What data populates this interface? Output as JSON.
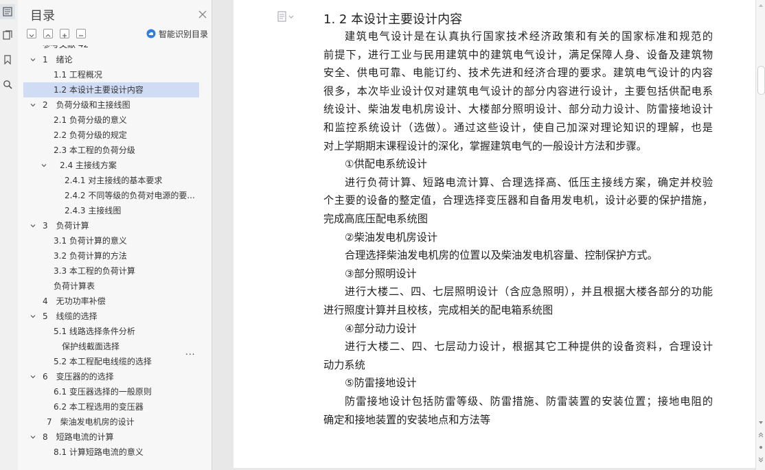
{
  "sidebar_rail": {
    "icons": [
      "toc-icon",
      "bookmark-list-icon",
      "bookmark-icon",
      "search-icon"
    ]
  },
  "panel": {
    "title": "目录",
    "smart_toc_label": "智能识别目录",
    "toc": [
      {
        "label": "参考文献 42",
        "level": 1,
        "expand": "none"
      },
      {
        "label": "1　绪论",
        "level": 1,
        "expand": "expanded"
      },
      {
        "label": "1.1 工程概况",
        "level": 2,
        "expand": "none"
      },
      {
        "label": "1.2 本设计主要设计内容",
        "level": 2,
        "expand": "none",
        "selected": true
      },
      {
        "label": "2　负荷分级和主接线图",
        "level": 1,
        "expand": "expanded"
      },
      {
        "label": "2.1 负荷分级的意义",
        "level": 2,
        "expand": "none"
      },
      {
        "label": "2.2 负荷分级的规定",
        "level": 2,
        "expand": "none"
      },
      {
        "label": "2.3 本工程的负荷分级",
        "level": 2,
        "expand": "none"
      },
      {
        "label": "2.4 主接线方案",
        "level": 2,
        "expand": "expanded",
        "pad": 9
      },
      {
        "label": "2.4.1 对主接线的基本要求",
        "level": 3,
        "expand": "none"
      },
      {
        "label": "2.4.2 不同等级的负荷对电源的要...",
        "level": 3,
        "expand": "none"
      },
      {
        "label": "2.4.3 主接线图",
        "level": 3,
        "expand": "none"
      },
      {
        "label": "3　负荷计算",
        "level": 1,
        "expand": "expanded"
      },
      {
        "label": "3.1 负荷计算的意义",
        "level": 2,
        "expand": "none"
      },
      {
        "label": "3.2 负荷计算的方法",
        "level": 2,
        "expand": "none"
      },
      {
        "label": "3.3 本工程的负荷计算",
        "level": 2,
        "expand": "none"
      },
      {
        "label": "负荷计算表",
        "level": 2,
        "expand": "none"
      },
      {
        "label": "4　无功功率补偿",
        "level": 1,
        "expand": "none"
      },
      {
        "label": "5　线缆的选择",
        "level": 1,
        "expand": "expanded"
      },
      {
        "label": "5.1 线路选择条件分析",
        "level": 2,
        "expand": "none"
      },
      {
        "label": "保护线截面选择",
        "level": 2,
        "expand": "none",
        "pad": 12
      },
      {
        "label": "5.2 本工程配电线缆的选择",
        "level": 2,
        "expand": "none"
      },
      {
        "label": "6　变压器的的选择",
        "level": 1,
        "expand": "expanded"
      },
      {
        "label": "6.1 变压器选择的一般原则",
        "level": 2,
        "expand": "none"
      },
      {
        "label": "6.2 本工程选用的变压器",
        "level": 2,
        "expand": "none"
      },
      {
        "label": "7　柴油发电机房的设计",
        "level": 1,
        "expand": "none",
        "pad": 6
      },
      {
        "label": "8　短路电流的计算",
        "level": 1,
        "expand": "expanded"
      },
      {
        "label": "8.1 计算短路电流的意义",
        "level": 2,
        "expand": "none"
      }
    ],
    "more_label": "..."
  },
  "document": {
    "heading": "1. 2 本设计主要设计内容",
    "lines": [
      {
        "text": "建筑电气设计是在认真执行国家技术经济政策和有关的国家标准和规范的",
        "indent": true,
        "justify": true
      },
      {
        "text": "前提下，进行工业与民用建筑中的建筑电气设计，满足保障人身、设备及建筑物",
        "indent": false,
        "justify": true
      },
      {
        "text": "安全、供电可靠、电能订约、技术先进和经济合理的要求。建筑电气设计的内容",
        "indent": false,
        "justify": true
      },
      {
        "text": "很多，本次毕业设计仅对建筑电气设计的部分内容进行设计，主要包括供配电系",
        "indent": false,
        "justify": true
      },
      {
        "text": "统设计、柴油发电机房设计、大楼部分照明设计、部分动力设计、防雷接地设计",
        "indent": false,
        "justify": true
      },
      {
        "text": "和监控系统设计（选做）。通过这些设计，使自己加深对理论知识的理解，也是",
        "indent": false,
        "justify": true
      },
      {
        "text": "对上学期期末课程设计的深化，掌握建筑电气的一般设计方法和步骤。",
        "indent": false,
        "justify": false
      },
      {
        "text": "①供配电系统设计",
        "indent": true,
        "justify": false
      },
      {
        "text": "进行负荷计算、短路电流计算、合理选择高、低压主接线方案，确定并校验",
        "indent": true,
        "justify": true
      },
      {
        "text": "个主要的设备的整定值，合理选择变压器和自备用发电机，设计必要的保护措施，",
        "indent": false,
        "justify": true
      },
      {
        "text": "完成高底压配电系统图",
        "indent": false,
        "justify": false
      },
      {
        "text": "②柴油发电机房设计",
        "indent": true,
        "justify": false
      },
      {
        "text": "合理选择柴油发电机房的位置以及柴油发电机容量、控制保护方式。",
        "indent": true,
        "justify": false
      },
      {
        "text": "③部分照明设计",
        "indent": true,
        "justify": false
      },
      {
        "text": "进行大楼二、四、七层照明设计（含应急照明），并且根据大楼各部分的功能",
        "indent": true,
        "justify": true
      },
      {
        "text": "进行照度计算并且校核，完成相关的配电箱系统图",
        "indent": false,
        "justify": false
      },
      {
        "text": "④部分动力设计",
        "indent": true,
        "justify": false
      },
      {
        "text": "进行大楼二、四、七层动力设计，根据其它工种提供的设备资料，合理设计",
        "indent": true,
        "justify": true
      },
      {
        "text": "动力系统",
        "indent": false,
        "justify": false
      },
      {
        "text": "⑤防雷接地设计",
        "indent": true,
        "justify": false
      },
      {
        "text": "防雷接地设计包括防雷等级、防雷措施、防雷装置的安装位置；接地电阻的",
        "indent": true,
        "justify": true
      },
      {
        "text": "确定和接地装置的安装地点和方法等",
        "indent": false,
        "justify": false
      }
    ]
  },
  "colors": {
    "selected_bg": "#cfdcf4",
    "accent": "#2f7de1"
  }
}
